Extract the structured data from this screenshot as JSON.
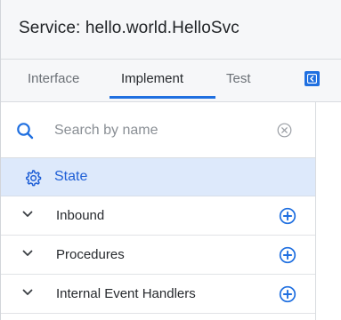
{
  "header": {
    "title": "Service: hello.world.HelloSvc"
  },
  "tabs": [
    {
      "label": "Interface"
    },
    {
      "label": "Implement"
    },
    {
      "label": "Test"
    }
  ],
  "active_tab": "Implement",
  "search": {
    "placeholder": "Search by name",
    "value": ""
  },
  "state_item": {
    "label": "State"
  },
  "sections": [
    {
      "label": "Inbound"
    },
    {
      "label": "Procedures"
    },
    {
      "label": "Internal Event Handlers"
    }
  ],
  "colors": {
    "accent": "#1f6fe0",
    "selected_bg": "#dde9fb"
  },
  "icons": [
    "search-icon",
    "clear-icon",
    "gear-icon",
    "chevron-down-icon",
    "add-circle-icon",
    "collapse-panel-icon"
  ]
}
